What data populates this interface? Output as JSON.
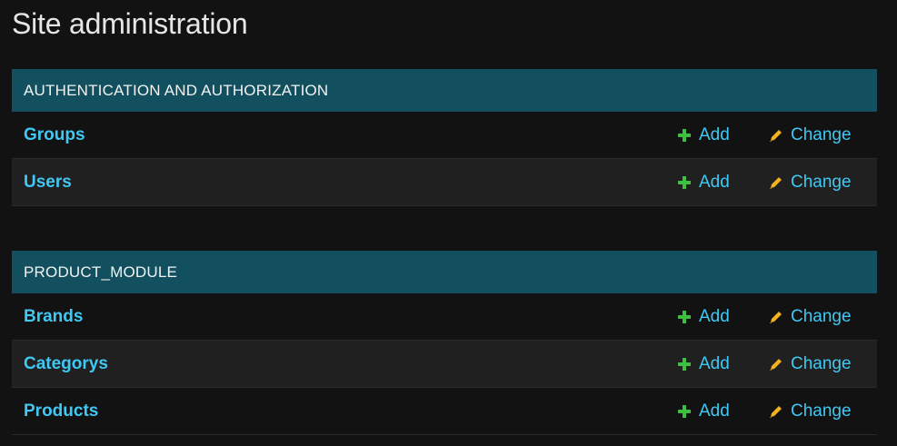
{
  "page": {
    "title": "Site administration"
  },
  "colors": {
    "background": "#121212",
    "header": "#12505f",
    "link": "#3fc8f3",
    "add_icon": "#3fbf3f",
    "change_icon": "#f2b21e"
  },
  "modules": [
    {
      "name": "AUTHENTICATION AND AUTHORIZATION",
      "models": [
        {
          "name": "Groups",
          "add_label": "Add",
          "change_label": "Change"
        },
        {
          "name": "Users",
          "add_label": "Add",
          "change_label": "Change"
        }
      ]
    },
    {
      "name": "PRODUCT_MODULE",
      "models": [
        {
          "name": "Brands",
          "add_label": "Add",
          "change_label": "Change"
        },
        {
          "name": "Categorys",
          "add_label": "Add",
          "change_label": "Change"
        },
        {
          "name": "Products",
          "add_label": "Add",
          "change_label": "Change"
        }
      ]
    }
  ]
}
